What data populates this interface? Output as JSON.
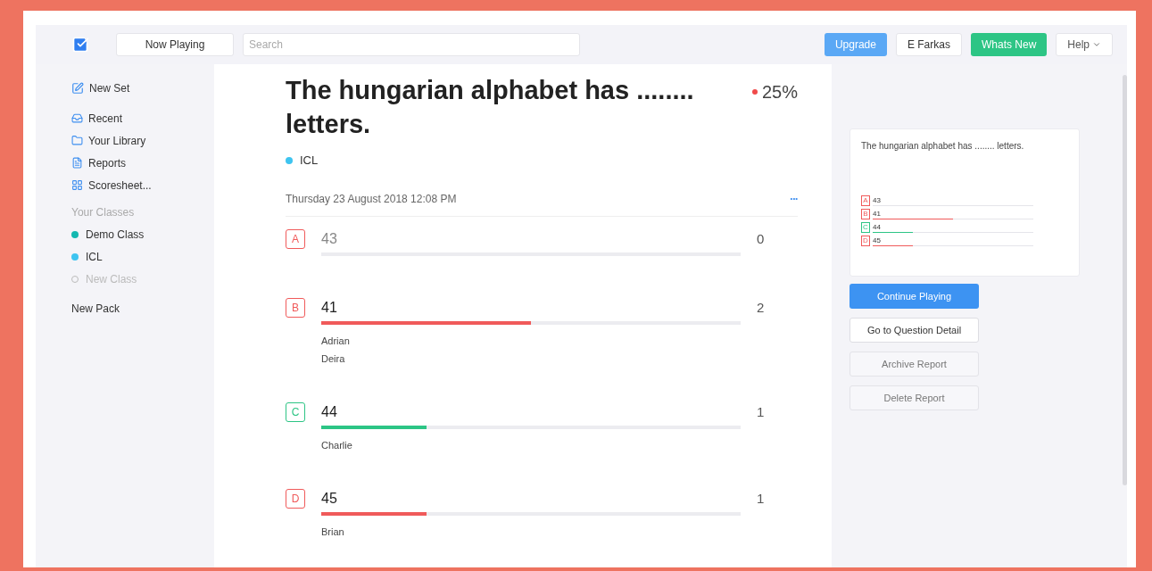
{
  "topbar": {
    "now_playing": "Now Playing",
    "search": {
      "placeholder": "Search"
    },
    "buttons": [
      {
        "label": "Upgrade",
        "kind": "primary"
      },
      {
        "label": "E Farkas",
        "kind": "plain"
      },
      {
        "label": "Whats New",
        "kind": "success"
      },
      {
        "label": "Help",
        "kind": "menu"
      }
    ]
  },
  "sidebar": {
    "new_set": "New Set",
    "items": [
      "Recent",
      "Your Library",
      "Reports",
      "Scoresheet..."
    ],
    "classes_heading": "Your Classes",
    "classes": [
      {
        "label": "Demo Class",
        "color": "#14b8b0",
        "kind": "class"
      },
      {
        "label": "ICL",
        "color": "#3ec4f0",
        "kind": "class"
      },
      {
        "label": "New Class",
        "kind": "add"
      }
    ],
    "new_pack": "New Pack"
  },
  "question": {
    "title": "The hungarian alphabet has ........ letters.",
    "score": "25%",
    "class": {
      "label": "ICL",
      "color": "#3ec4f0"
    },
    "date": "Thursday 23 August 2018 12:08 PM",
    "more": "•••"
  },
  "answers": [
    {
      "letter": "A",
      "text": "43",
      "count": "0",
      "correct": false,
      "muted": true,
      "level": 0
    },
    {
      "letter": "B",
      "text": "41",
      "count": "2",
      "correct": false,
      "muted": false,
      "level": 0.5,
      "students": [
        "Adrian",
        "Deira"
      ]
    },
    {
      "letter": "C",
      "text": "44",
      "count": "1",
      "correct": true,
      "muted": false,
      "level": 0.25,
      "students": [
        "Charlie"
      ]
    },
    {
      "letter": "D",
      "text": "45",
      "count": "1",
      "correct": false,
      "muted": false,
      "level": 0.25,
      "students": [
        "Brian"
      ]
    }
  ],
  "preview": {
    "title": "The hungarian alphabet has ........ letters.",
    "answers": [
      {
        "letter": "A",
        "text": "43",
        "correct": false,
        "level": 0
      },
      {
        "letter": "B",
        "text": "41",
        "correct": false,
        "level": 0.5
      },
      {
        "letter": "C",
        "text": "44",
        "correct": true,
        "level": 0.25
      },
      {
        "letter": "D",
        "text": "45",
        "correct": false,
        "level": 0.25
      }
    ]
  },
  "actions": [
    {
      "label": "Continue Playing",
      "kind": "primary"
    },
    {
      "label": "Go to Question Detail",
      "kind": "plain"
    },
    {
      "label": "Archive Report",
      "kind": "muted"
    },
    {
      "label": "Delete Report",
      "kind": "muted"
    }
  ]
}
